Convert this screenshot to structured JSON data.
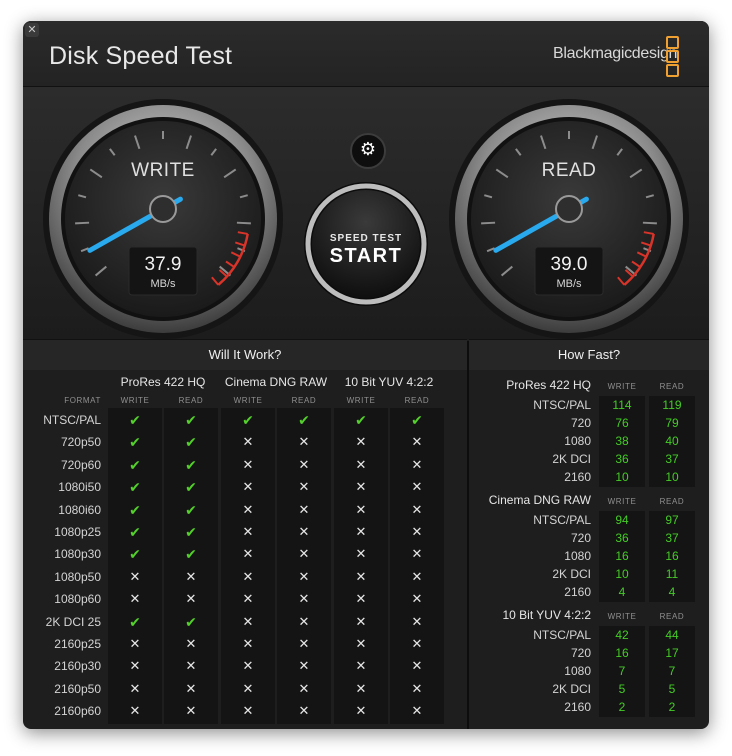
{
  "app": {
    "title": "Disk Speed Test",
    "brand": "Blackmagicdesign",
    "close_glyph": "✕"
  },
  "gauges": {
    "write": {
      "label": "WRITE",
      "value": "37.9",
      "unit": "MB/s",
      "speed": 37.9
    },
    "read": {
      "label": "READ",
      "value": "39.0",
      "unit": "MB/s",
      "speed": 39.0
    }
  },
  "start_button": {
    "top_label": "SPEED TEST",
    "main_label": "START"
  },
  "settings_button": {
    "icon": "gear-icon",
    "glyph": "⚙"
  },
  "will_it_work": {
    "title": "Will It Work?",
    "format_header": "FORMAT",
    "groups": [
      {
        "name": "ProRes 422 HQ",
        "write_label": "WRITE",
        "read_label": "READ"
      },
      {
        "name": "Cinema DNG RAW",
        "write_label": "WRITE",
        "read_label": "READ"
      },
      {
        "name": "10 Bit YUV 4:2:2",
        "write_label": "WRITE",
        "read_label": "READ"
      }
    ],
    "rows": [
      {
        "format": "NTSC/PAL",
        "marks": [
          "✔",
          "✔",
          "✔",
          "✔",
          "✔",
          "✔"
        ]
      },
      {
        "format": "720p50",
        "marks": [
          "✔",
          "✔",
          "✕",
          "✕",
          "✕",
          "✕"
        ]
      },
      {
        "format": "720p60",
        "marks": [
          "✔",
          "✔",
          "✕",
          "✕",
          "✕",
          "✕"
        ]
      },
      {
        "format": "1080i50",
        "marks": [
          "✔",
          "✔",
          "✕",
          "✕",
          "✕",
          "✕"
        ]
      },
      {
        "format": "1080i60",
        "marks": [
          "✔",
          "✔",
          "✕",
          "✕",
          "✕",
          "✕"
        ]
      },
      {
        "format": "1080p25",
        "marks": [
          "✔",
          "✔",
          "✕",
          "✕",
          "✕",
          "✕"
        ]
      },
      {
        "format": "1080p30",
        "marks": [
          "✔",
          "✔",
          "✕",
          "✕",
          "✕",
          "✕"
        ]
      },
      {
        "format": "1080p50",
        "marks": [
          "✕",
          "✕",
          "✕",
          "✕",
          "✕",
          "✕"
        ]
      },
      {
        "format": "1080p60",
        "marks": [
          "✕",
          "✕",
          "✕",
          "✕",
          "✕",
          "✕"
        ]
      },
      {
        "format": "2K DCI 25",
        "marks": [
          "✔",
          "✔",
          "✕",
          "✕",
          "✕",
          "✕"
        ]
      },
      {
        "format": "2160p25",
        "marks": [
          "✕",
          "✕",
          "✕",
          "✕",
          "✕",
          "✕"
        ]
      },
      {
        "format": "2160p30",
        "marks": [
          "✕",
          "✕",
          "✕",
          "✕",
          "✕",
          "✕"
        ]
      },
      {
        "format": "2160p50",
        "marks": [
          "✕",
          "✕",
          "✕",
          "✕",
          "✕",
          "✕"
        ]
      },
      {
        "format": "2160p60",
        "marks": [
          "✕",
          "✕",
          "✕",
          "✕",
          "✕",
          "✕"
        ]
      }
    ]
  },
  "how_fast": {
    "title": "How Fast?",
    "groups": [
      {
        "name": "ProRes 422 HQ",
        "write_label": "WRITE",
        "read_label": "READ",
        "rows": [
          {
            "format": "NTSC/PAL",
            "write": "114",
            "read": "119"
          },
          {
            "format": "720",
            "write": "76",
            "read": "79"
          },
          {
            "format": "1080",
            "write": "38",
            "read": "40"
          },
          {
            "format": "2K DCI",
            "write": "36",
            "read": "37"
          },
          {
            "format": "2160",
            "write": "10",
            "read": "10"
          }
        ]
      },
      {
        "name": "Cinema DNG RAW",
        "write_label": "WRITE",
        "read_label": "READ",
        "rows": [
          {
            "format": "NTSC/PAL",
            "write": "94",
            "read": "97"
          },
          {
            "format": "720",
            "write": "36",
            "read": "37"
          },
          {
            "format": "1080",
            "write": "16",
            "read": "16"
          },
          {
            "format": "2K DCI",
            "write": "10",
            "read": "11"
          },
          {
            "format": "2160",
            "write": "4",
            "read": "4"
          }
        ]
      },
      {
        "name": "10 Bit YUV 4:2:2",
        "write_label": "WRITE",
        "read_label": "READ",
        "rows": [
          {
            "format": "NTSC/PAL",
            "write": "42",
            "read": "44"
          },
          {
            "format": "720",
            "write": "16",
            "read": "17"
          },
          {
            "format": "1080",
            "write": "7",
            "read": "7"
          },
          {
            "format": "2K DCI",
            "write": "5",
            "read": "5"
          },
          {
            "format": "2160",
            "write": "2",
            "read": "2"
          }
        ]
      }
    ]
  },
  "colors": {
    "check": "#54d02c",
    "speed_number": "#45cc27",
    "needle": "#29a9ee",
    "redline": "#d8342a",
    "brand_accent": "#f0a030"
  }
}
